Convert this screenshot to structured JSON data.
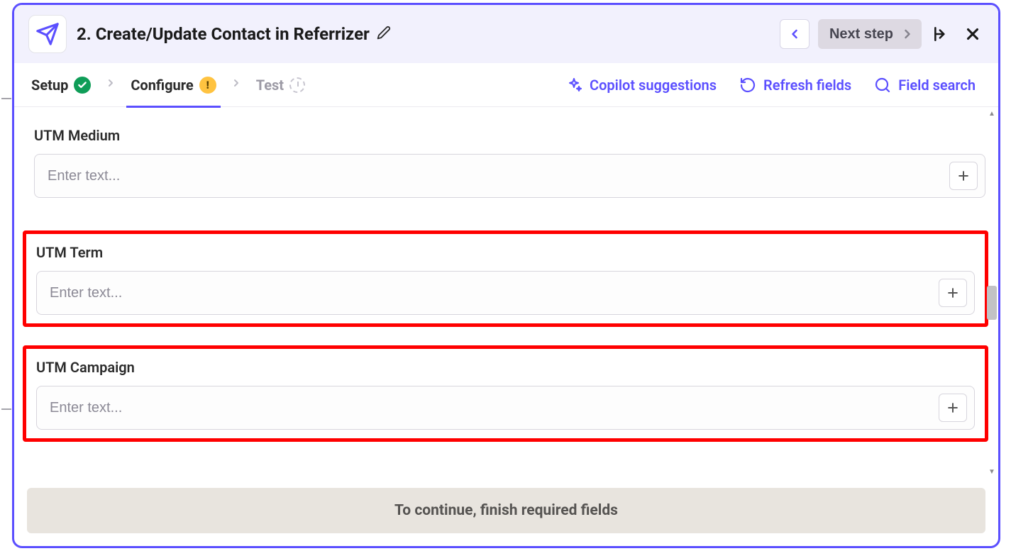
{
  "header": {
    "title": "2. Create/Update Contact in Referrizer",
    "next_label": "Next step"
  },
  "tabs": {
    "setup": "Setup",
    "configure": "Configure",
    "test": "Test"
  },
  "actions": {
    "copilot": "Copilot suggestions",
    "refresh": "Refresh fields",
    "search": "Field search"
  },
  "fields": [
    {
      "label": "UTM Medium",
      "placeholder": "Enter text...",
      "highlighted": false
    },
    {
      "label": "UTM Term",
      "placeholder": "Enter text...",
      "highlighted": true
    },
    {
      "label": "UTM Campaign",
      "placeholder": "Enter text...",
      "highlighted": true
    }
  ],
  "footer": {
    "message": "To continue, finish required fields"
  }
}
